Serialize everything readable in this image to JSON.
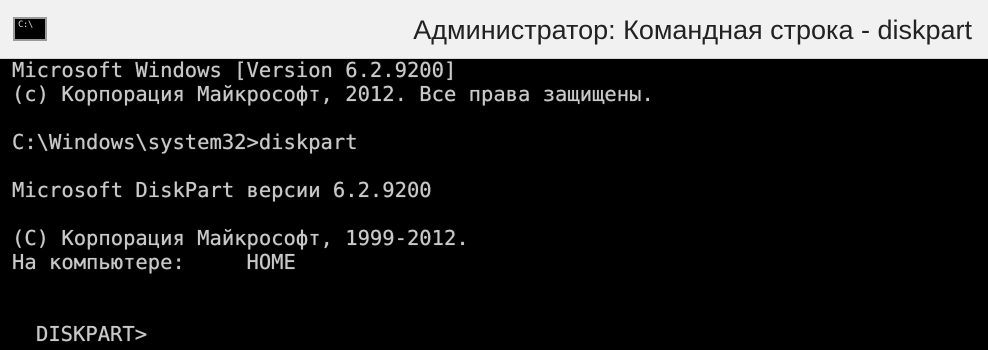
{
  "window": {
    "title": "Администратор: Командная строка - diskpart",
    "icon": "cmd-icon",
    "icon_label": "C:\\",
    "colors": {
      "titlebar": "#f1f1f1",
      "title_text": "#222222",
      "console_bg": "#000000",
      "console_text": "#c9c9c9"
    }
  },
  "console": {
    "line_1": "Microsoft Windows [Version 6.2.9200]",
    "line_2": "(c) Корпорация Майкрософт, 2012. Все права защищены.",
    "line_3": "C:\\Windows\\system32>diskpart",
    "line_4": "Microsoft DiskPart версии 6.2.9200",
    "line_5": "(C) Корпорация Майкрософт, 1999-2012.",
    "line_6": "На компьютере:     HOME",
    "prompt": "DISKPART>"
  }
}
